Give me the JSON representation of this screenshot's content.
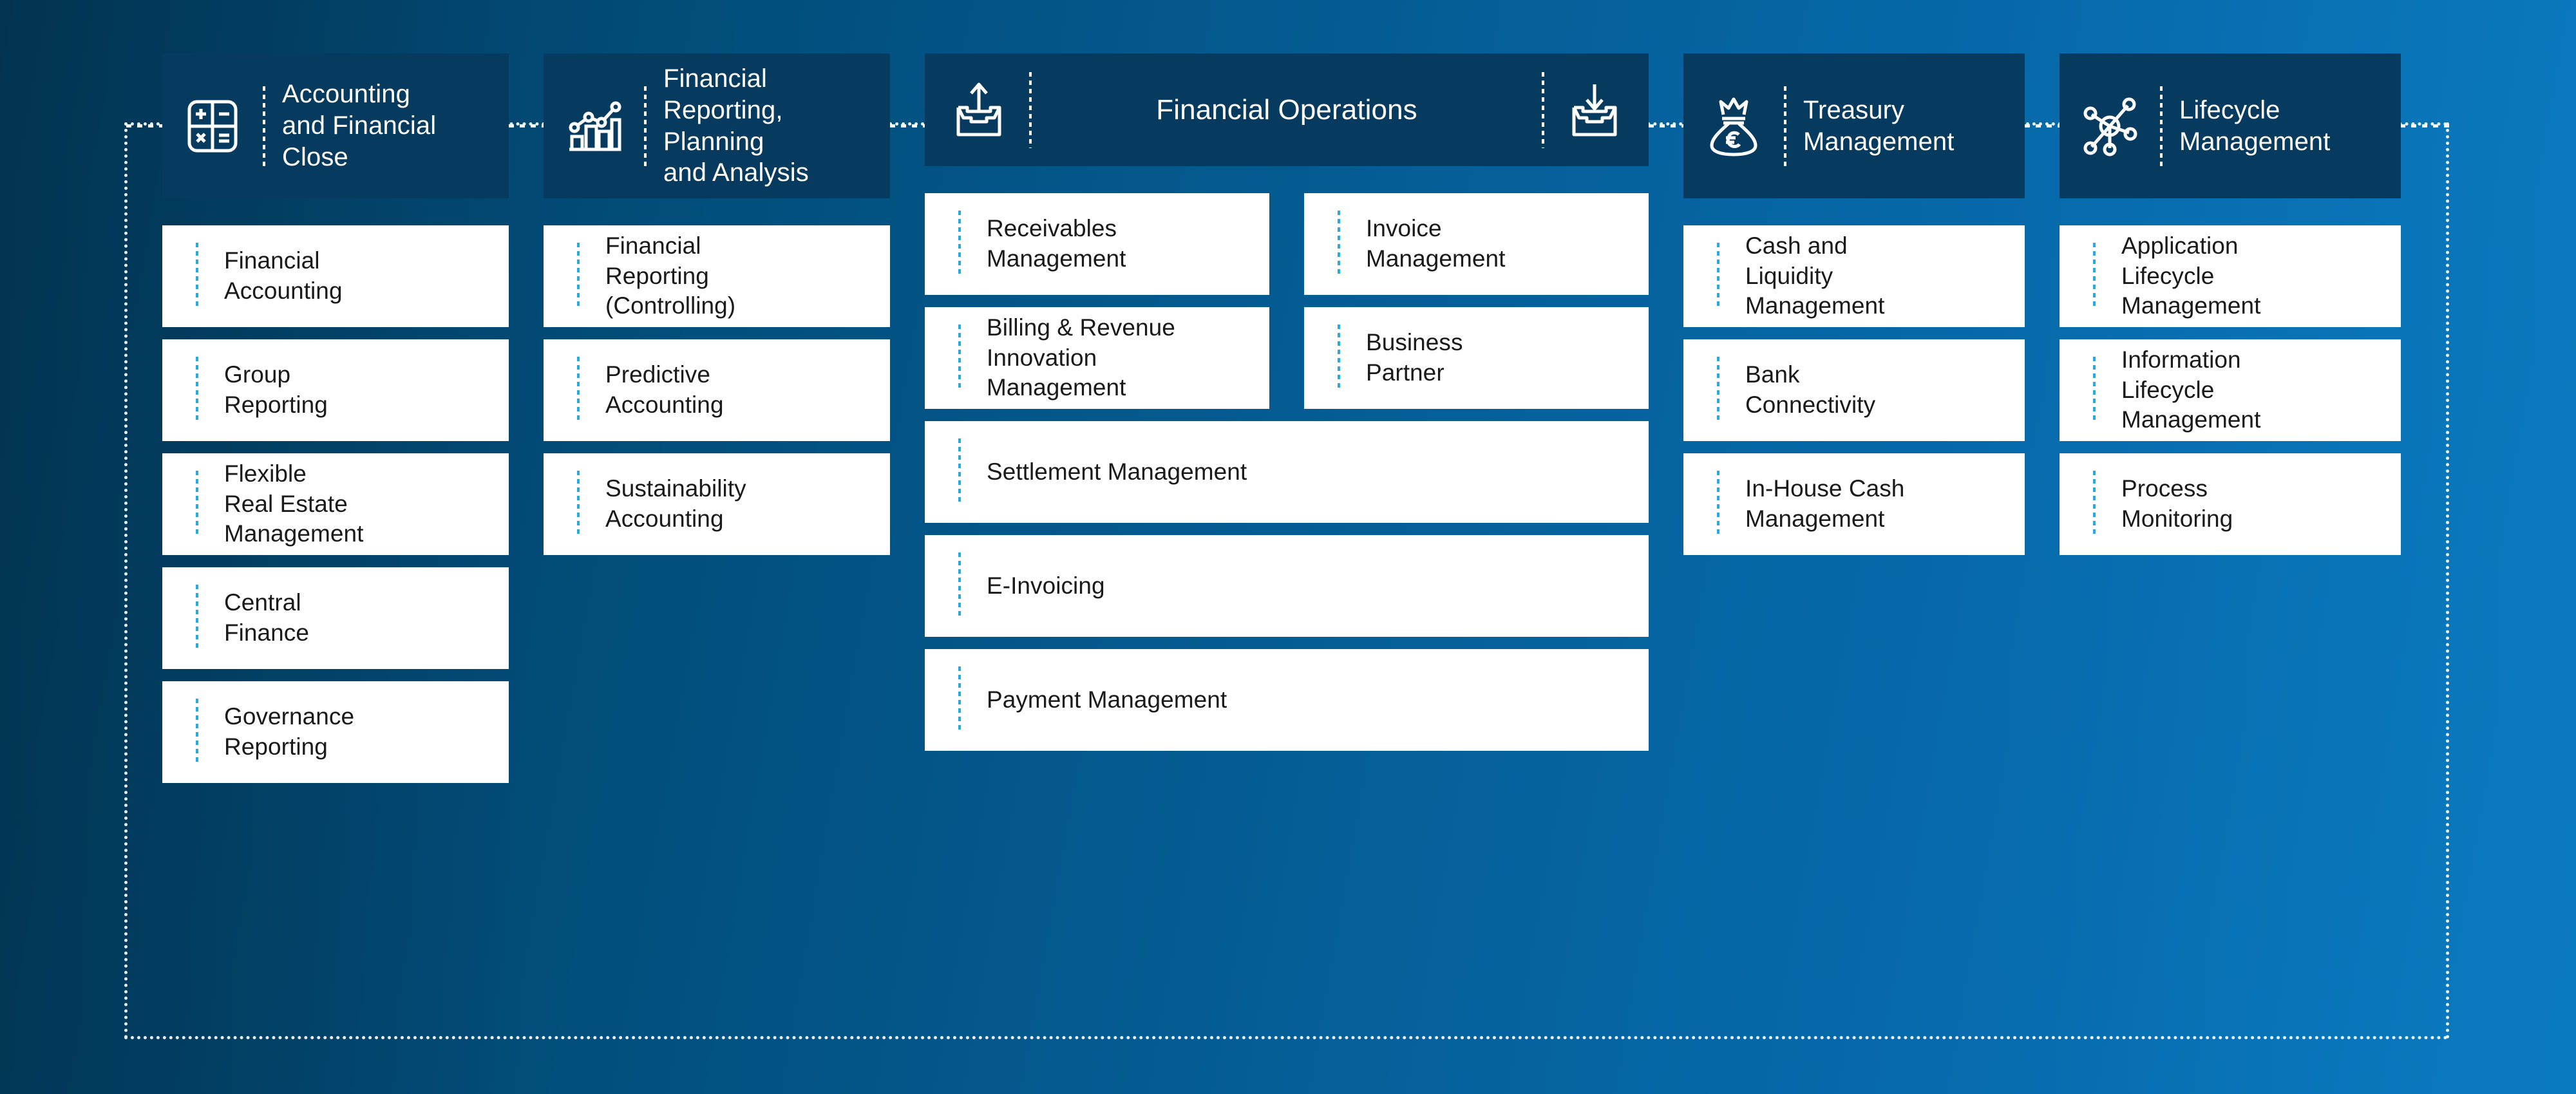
{
  "theme": {
    "background_left": "#023a5c",
    "background_right": "#0877bd",
    "header_box": "#063a5e",
    "card_background": "#ffffff",
    "card_accent": "#2aa9e0",
    "frame_border": "#ffffff",
    "text_on_dark": "#ffffff",
    "text_on_light": "#1a1a1a"
  },
  "columns": [
    {
      "id": "accounting-and-financial-close",
      "header": {
        "title": "Accounting\nand Financial\nClose",
        "icon": "calculator-icon"
      },
      "cards": [
        {
          "label": "Financial\nAccounting"
        },
        {
          "label": "Group\nReporting"
        },
        {
          "label": "Flexible\nReal Estate\nManagement"
        },
        {
          "label": "Central\nFinance"
        },
        {
          "label": "Governance\nReporting"
        }
      ]
    },
    {
      "id": "financial-reporting-planning-and-analysis",
      "header": {
        "title": "Financial\nReporting,\nPlanning\nand Analysis",
        "icon": "bar-chart-trend-icon"
      },
      "cards": [
        {
          "label": "Financial\nReporting\n(Controlling)"
        },
        {
          "label": "Predictive\nAccounting"
        },
        {
          "label": "Sustainability\nAccounting"
        }
      ]
    },
    {
      "id": "financial-operations",
      "header": {
        "title": "Financial Operations",
        "icon_left": "outbox-up-arrow-icon",
        "icon_right": "inbox-down-arrow-icon"
      },
      "cards": [
        {
          "label": "Receivables\nManagement",
          "span": 1
        },
        {
          "label": "Invoice\nManagement",
          "span": 1
        },
        {
          "label": "Billing & Revenue\nInnovation\nManagement",
          "span": 1
        },
        {
          "label": "Business\nPartner",
          "span": 1
        },
        {
          "label": "Settlement Management",
          "span": 2
        },
        {
          "label": "E-Invoicing",
          "span": 2
        },
        {
          "label": "Payment Management",
          "span": 2
        }
      ]
    },
    {
      "id": "treasury-management",
      "header": {
        "title": "Treasury\nManagement",
        "icon": "money-bag-euro-crown-icon"
      },
      "cards": [
        {
          "label": "Cash and\nLiquidity\nManagement"
        },
        {
          "label": "Bank\nConnectivity"
        },
        {
          "label": "In-House Cash\nManagement"
        }
      ]
    },
    {
      "id": "lifecycle-management",
      "header": {
        "title": "Lifecycle\nManagement",
        "icon": "network-hub-nodes-icon"
      },
      "cards": [
        {
          "label": "Application\nLifecycle\nManagement"
        },
        {
          "label": "Information\nLifecycle\nManagement"
        },
        {
          "label": "Process\nMonitoring"
        }
      ]
    }
  ]
}
